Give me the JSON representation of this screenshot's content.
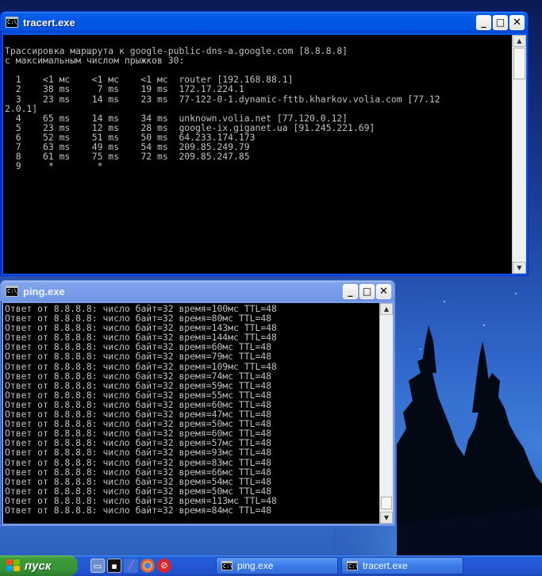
{
  "tracert": {
    "title": "tracert.exe",
    "lines": [
      "",
      "Трассировка маршрута к google-public-dns-a.google.com [8.8.8.8]",
      "с максимальным числом прыжков 30:",
      "",
      "  1    <1 мс    <1 мс    <1 мс  router [192.168.88.1]",
      "  2    38 ms     7 ms    19 ms  172.17.224.1",
      "  3    23 ms    14 ms    23 ms  77-122-0-1.dynamic-fttb.kharkov.volia.com [77.12",
      "2.0.1]",
      "  4    65 ms    14 ms    34 ms  unknown.volia.net [77.120.0.12]",
      "  5    23 ms    12 ms    28 ms  google-ix.giganet.ua [91.245.221.69]",
      "  6    52 ms    51 ms    50 ms  64.233.174.173",
      "  7    63 ms    49 ms    54 ms  209.85.249.79",
      "  8    61 ms    75 ms    72 ms  209.85.247.85",
      "  9     *        *"
    ]
  },
  "ping": {
    "title": "ping.exe",
    "lines": [
      "Ответ от 8.8.8.8: число байт=32 время=100мс TTL=48",
      "Ответ от 8.8.8.8: число байт=32 время=80мс TTL=48",
      "Ответ от 8.8.8.8: число байт=32 время=143мс TTL=48",
      "Ответ от 8.8.8.8: число байт=32 время=144мс TTL=48",
      "Ответ от 8.8.8.8: число байт=32 время=60мс TTL=48",
      "Ответ от 8.8.8.8: число байт=32 время=79мс TTL=48",
      "Ответ от 8.8.8.8: число байт=32 время=109мс TTL=48",
      "Ответ от 8.8.8.8: число байт=32 время=74мс TTL=48",
      "Ответ от 8.8.8.8: число байт=32 время=59мс TTL=48",
      "Ответ от 8.8.8.8: число байт=32 время=55мс TTL=48",
      "Ответ от 8.8.8.8: число байт=32 время=60мс TTL=48",
      "Ответ от 8.8.8.8: число байт=32 время=47мс TTL=48",
      "Ответ от 8.8.8.8: число байт=32 время=50мс TTL=48",
      "Ответ от 8.8.8.8: число байт=32 время=60мс TTL=48",
      "Ответ от 8.8.8.8: число байт=32 время=57мс TTL=48",
      "Ответ от 8.8.8.8: число байт=32 время=93мс TTL=48",
      "Ответ от 8.8.8.8: число байт=32 время=83мс TTL=48",
      "Ответ от 8.8.8.8: число байт=32 время=66мс TTL=48",
      "Ответ от 8.8.8.8: число байт=32 время=54мс TTL=48",
      "Ответ от 8.8.8.8: число байт=32 время=50мс TTL=48",
      "Ответ от 8.8.8.8: число байт=32 время=113мс TTL=48",
      "Ответ от 8.8.8.8: число байт=32 время=84мс TTL=48"
    ]
  },
  "window_buttons": {
    "minimize": "_",
    "maximize": "□",
    "close": "✕"
  },
  "console_icon_text": "C:\\",
  "taskbar": {
    "start_label": "пуск",
    "tasks": [
      {
        "label": "ping.exe"
      },
      {
        "label": "tracert.exe"
      }
    ]
  },
  "icons": {
    "start": "windows-flag-icon",
    "quick_launch": [
      "show-desktop-icon",
      "console-icon",
      "pen-tool-icon",
      "chrome-icon",
      "opera-icon"
    ]
  },
  "colors": {
    "titlebar_active": "#0058e6",
    "titlebar_inactive": "#7a9eea",
    "console_bg": "#000000",
    "console_fg": "#c0c0c0",
    "start_green": "#379334",
    "taskbar_blue": "#2457d6"
  }
}
